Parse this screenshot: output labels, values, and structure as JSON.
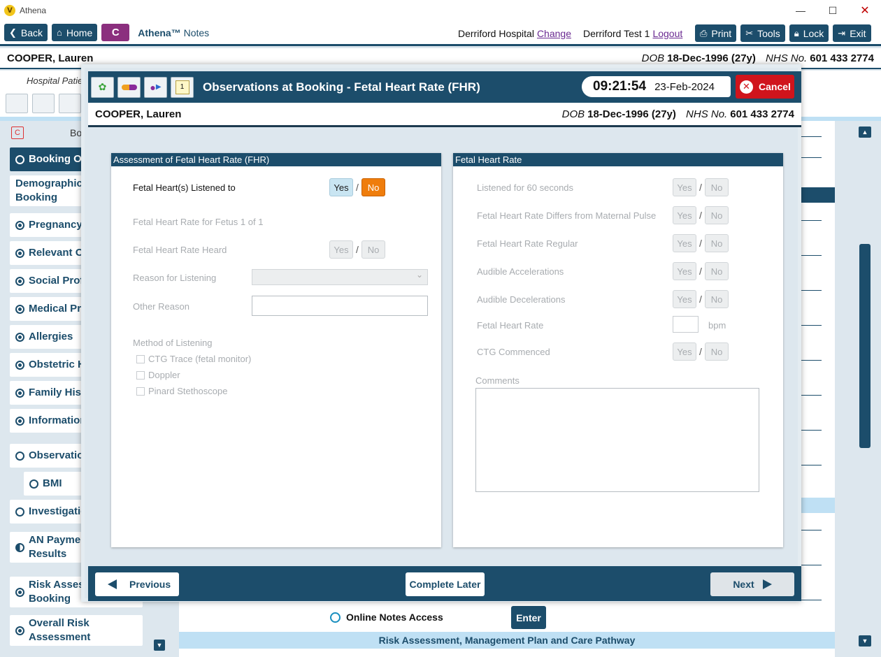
{
  "window": {
    "title": "Athena"
  },
  "toolbar": {
    "back": "Back",
    "home": "Home",
    "c_badge": "C",
    "brand_name": "Athena™",
    "brand_section": "Notes",
    "hospital": "Derriford Hospital",
    "change_link": "Change",
    "user": "Derriford Test 1",
    "logout_link": "Logout",
    "print": "Print",
    "tools": "Tools",
    "lock": "Lock",
    "exit": "Exit"
  },
  "patient": {
    "name": "COOPER, Lauren",
    "dob_label": "DOB",
    "dob": "18-Dec-1996 (27y)",
    "nhs_label": "NHS No.",
    "nhs": "601 433 2774"
  },
  "background": {
    "subbar_text": "Hospital Patie",
    "side_c": "C",
    "side_bo": "Bo",
    "nav": [
      {
        "label": "Booking Ov",
        "state": "active"
      },
      {
        "label": "Demographics\nBooking",
        "state": "none"
      },
      {
        "label": "Pregnancy I",
        "state": "filled"
      },
      {
        "label": "Relevant Ot",
        "state": "filled"
      },
      {
        "label": "Social Profil",
        "state": "filled"
      },
      {
        "label": "Medical Pro",
        "state": "filled"
      },
      {
        "label": "Allergies",
        "state": "filled"
      },
      {
        "label": "Obstetric H",
        "state": "filled"
      },
      {
        "label": "Family Histo",
        "state": "filled"
      },
      {
        "label": "Information",
        "state": "filled"
      },
      {
        "label": "Observation",
        "state": "empty"
      },
      {
        "label": "BMI",
        "state": "empty"
      },
      {
        "label": "Investigatio",
        "state": "empty"
      },
      {
        "label": "AN Paymen\nResults",
        "state": "half"
      },
      {
        "label": "Risk Assess\nBooking",
        "state": "filled"
      },
      {
        "label": "Overall Risk\nAssessment",
        "state": "filled"
      }
    ],
    "online_notes": "Online Notes Access",
    "enter": "Enter",
    "risk_bar": "Risk Assessment, Management Plan and Care Pathway"
  },
  "modal": {
    "title": "Observations at Booking - Fetal Heart Rate (FHR)",
    "time": "09:21:54",
    "date": "23-Feb-2024",
    "cancel": "Cancel",
    "yes": "Yes",
    "no": "No",
    "left": {
      "header": "Assessment of Fetal Heart Rate (FHR)",
      "listened_to": "Fetal Heart(s) Listened to",
      "fetus_rate": "Fetal Heart Rate for Fetus 1 of 1",
      "rate_heard": "Fetal Heart Rate Heard",
      "reason": "Reason for Listening",
      "other_reason": "Other Reason",
      "method": "Method of Listening",
      "methods": [
        "CTG Trace (fetal monitor)",
        "Doppler",
        "Pinard Stethoscope"
      ]
    },
    "right": {
      "header": "Fetal Heart Rate",
      "q60": "Listened for 60 seconds",
      "differs": "Fetal Heart Rate Differs from Maternal Pulse",
      "regular": "Fetal Heart Rate Regular",
      "accel": "Audible Accelerations",
      "decel": "Audible Decelerations",
      "rate": "Fetal Heart Rate",
      "bpm": "bpm",
      "ctg": "CTG Commenced",
      "comments": "Comments"
    },
    "footer": {
      "previous": "Previous",
      "complete_later": "Complete Later",
      "next": "Next"
    }
  }
}
